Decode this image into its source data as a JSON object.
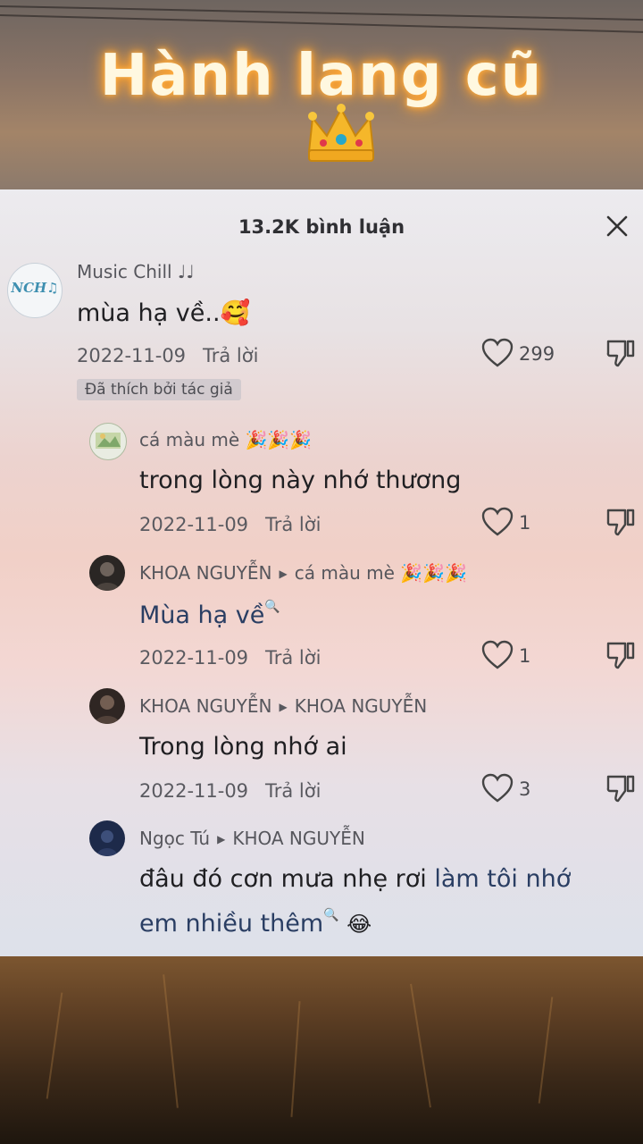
{
  "banner": {
    "title": "Hành lang cũ"
  },
  "header": {
    "title": "13.2K bình luận"
  },
  "comments": [
    {
      "avatar_text": "NCH♫",
      "user": "Music Chill ♩♩",
      "text": "mùa hạ về..🥰",
      "date": "2022-11-09",
      "reply": "Trả lời",
      "likes": "299",
      "badge": "Đã thích bởi tác giả"
    },
    {
      "user": "cá màu mè 🎉🎉🎉",
      "text": "trong lòng này nhớ thương",
      "date": "2022-11-09",
      "reply": "Trả lời",
      "likes": "1"
    },
    {
      "user": "KHOA NGUYỄN",
      "reply_to": "cá màu mè 🎉🎉🎉",
      "text": "Mùa hạ về",
      "date": "2022-11-09",
      "reply": "Trả lời",
      "likes": "1"
    },
    {
      "user": "KHOA NGUYỄN",
      "reply_to": "KHOA NGUYỄN",
      "text": "Trong lòng nhớ ai",
      "date": "2022-11-09",
      "reply": "Trả lời",
      "likes": "3"
    },
    {
      "user": "Ngọc Tú",
      "reply_to": "KHOA NGUYỄN",
      "text_plain": "đâu đó cơn mưa nhẹ rơi ",
      "text_link1": "làm tôi nhớ",
      "text_link2": "em nhiều thêm",
      "text_emoji": "😂"
    }
  ],
  "colors": {
    "link": "#2a3e63",
    "title_glow": "#ffaa40"
  }
}
